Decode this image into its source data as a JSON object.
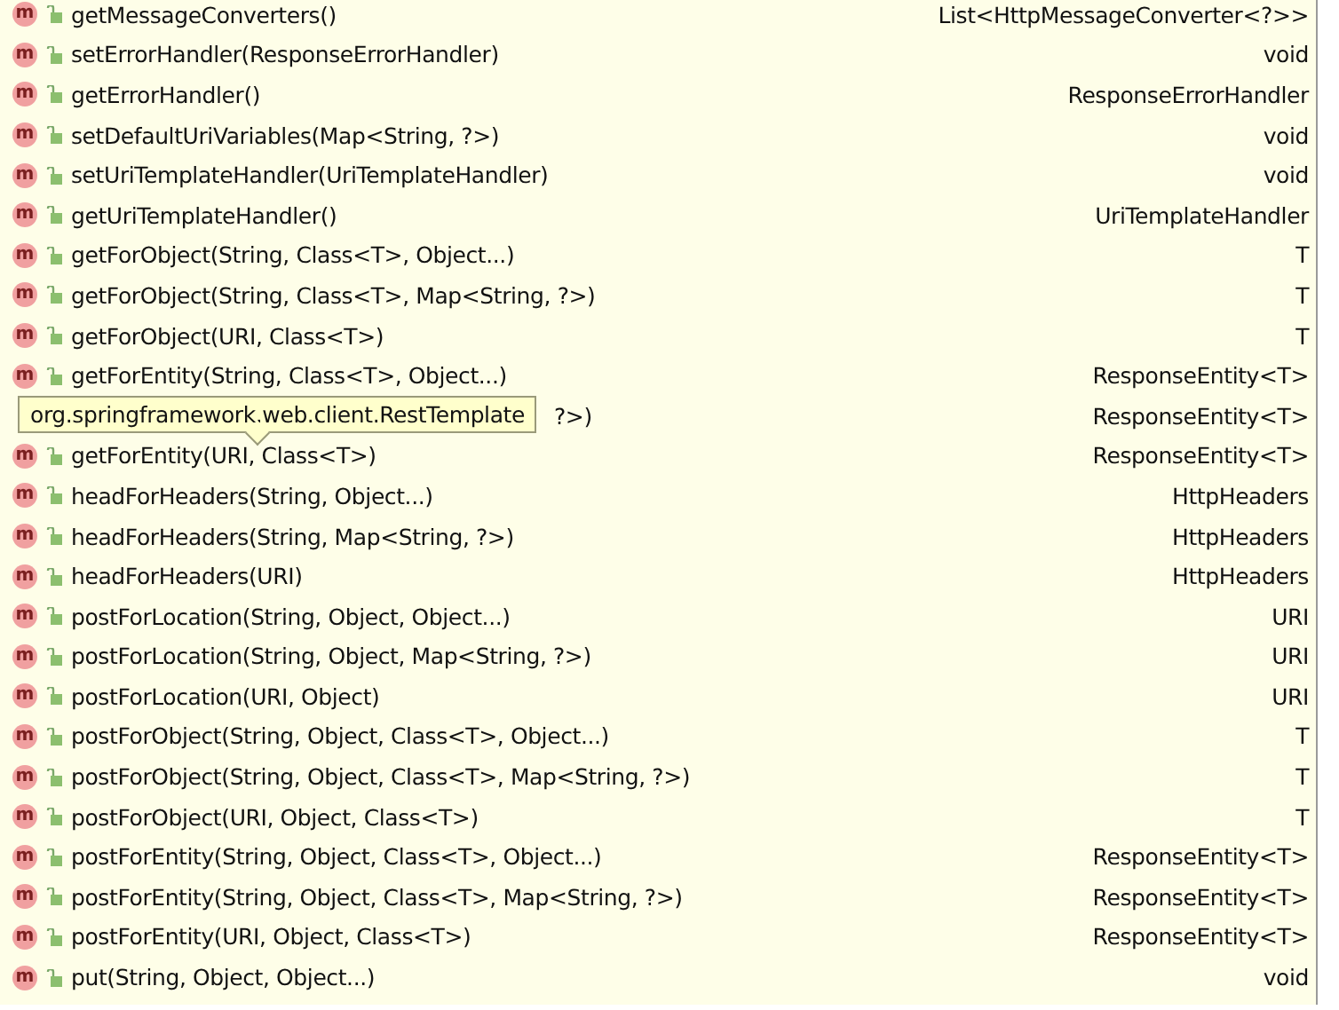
{
  "tooltip": "org.springframework.web.client.RestTemplate",
  "methods": [
    {
      "icon_letter": "m",
      "name": "getMessageConverters()",
      "type": "List<HttpMessageConverter<?>>",
      "covered": false
    },
    {
      "icon_letter": "m",
      "name": "setErrorHandler(ResponseErrorHandler)",
      "type": "void",
      "covered": false
    },
    {
      "icon_letter": "m",
      "name": "getErrorHandler()",
      "type": "ResponseErrorHandler",
      "covered": false
    },
    {
      "icon_letter": "m",
      "name": "setDefaultUriVariables(Map<String, ?>)",
      "type": "void",
      "covered": false
    },
    {
      "icon_letter": "m",
      "name": "setUriTemplateHandler(UriTemplateHandler)",
      "type": "void",
      "covered": false
    },
    {
      "icon_letter": "m",
      "name": "getUriTemplateHandler()",
      "type": "UriTemplateHandler",
      "covered": false
    },
    {
      "icon_letter": "m",
      "name": "getForObject(String, Class<T>, Object...)",
      "type": "T",
      "covered": false
    },
    {
      "icon_letter": "m",
      "name": "getForObject(String, Class<T>, Map<String, ?>)",
      "type": "T",
      "covered": false
    },
    {
      "icon_letter": "m",
      "name": "getForObject(URI, Class<T>)",
      "type": "T",
      "covered": false
    },
    {
      "icon_letter": "m",
      "name": "getForEntity(String, Class<T>, Object...)",
      "type": "ResponseEntity<T>",
      "covered": false
    },
    {
      "name": "?>)",
      "type": "ResponseEntity<T>",
      "covered": true
    },
    {
      "icon_letter": "m",
      "name": "getForEntity(URI, Class<T>)",
      "type": "ResponseEntity<T>",
      "covered": false
    },
    {
      "icon_letter": "m",
      "name": "headForHeaders(String, Object...)",
      "type": "HttpHeaders",
      "covered": false
    },
    {
      "icon_letter": "m",
      "name": "headForHeaders(String, Map<String, ?>)",
      "type": "HttpHeaders",
      "covered": false
    },
    {
      "icon_letter": "m",
      "name": "headForHeaders(URI)",
      "type": "HttpHeaders",
      "covered": false
    },
    {
      "icon_letter": "m",
      "name": "postForLocation(String, Object, Object...)",
      "type": "URI",
      "covered": false
    },
    {
      "icon_letter": "m",
      "name": "postForLocation(String, Object, Map<String, ?>)",
      "type": "URI",
      "covered": false
    },
    {
      "icon_letter": "m",
      "name": "postForLocation(URI, Object)",
      "type": "URI",
      "covered": false
    },
    {
      "icon_letter": "m",
      "name": "postForObject(String, Object, Class<T>, Object...)",
      "type": "T",
      "covered": false
    },
    {
      "icon_letter": "m",
      "name": "postForObject(String, Object, Class<T>, Map<String, ?>)",
      "type": "T",
      "covered": false
    },
    {
      "icon_letter": "m",
      "name": "postForObject(URI, Object, Class<T>)",
      "type": "T",
      "covered": false
    },
    {
      "icon_letter": "m",
      "name": "postForEntity(String, Object, Class<T>, Object...)",
      "type": "ResponseEntity<T>",
      "covered": false
    },
    {
      "icon_letter": "m",
      "name": "postForEntity(String, Object, Class<T>, Map<String, ?>)",
      "type": "ResponseEntity<T>",
      "covered": false
    },
    {
      "icon_letter": "m",
      "name": "postForEntity(URI, Object, Class<T>)",
      "type": "ResponseEntity<T>",
      "covered": false
    },
    {
      "icon_letter": "m",
      "name": "put(String, Object, Object...)",
      "type": "void",
      "covered": false
    }
  ]
}
